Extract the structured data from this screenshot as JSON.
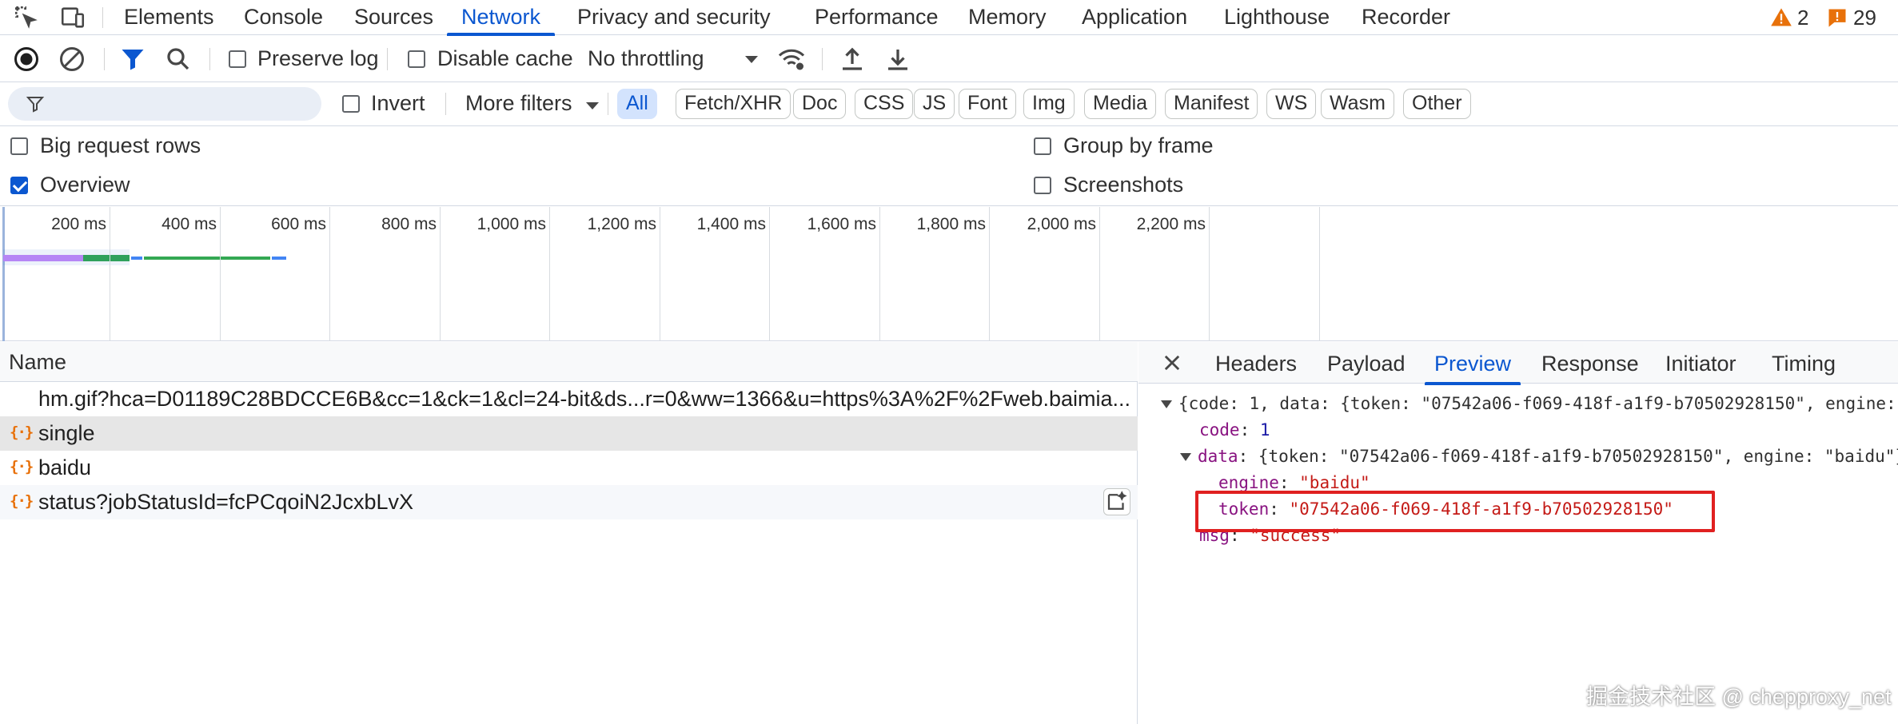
{
  "devtools_tabs": [
    {
      "label": "Elements"
    },
    {
      "label": "Console"
    },
    {
      "label": "Sources"
    },
    {
      "label": "Network"
    },
    {
      "label": "Privacy and security"
    },
    {
      "label": "Performance"
    },
    {
      "label": "Memory"
    },
    {
      "label": "Application"
    },
    {
      "label": "Lighthouse"
    },
    {
      "label": "Recorder"
    }
  ],
  "active_tab": "Network",
  "issues": {
    "warnings": "2",
    "errors": "29"
  },
  "toolbar": {
    "preserve_log_label": "Preserve log",
    "preserve_log_checked": false,
    "disable_cache_label": "Disable cache",
    "disable_cache_checked": false,
    "throttling_value": "No throttling"
  },
  "filter": {
    "value": "",
    "invert_label": "Invert",
    "more_filters_label": "More filters",
    "types": [
      "All",
      "Fetch/XHR",
      "Doc",
      "CSS",
      "JS",
      "Font",
      "Img",
      "Media",
      "Manifest",
      "WS",
      "Wasm",
      "Other"
    ],
    "active_type": "All"
  },
  "settings": {
    "big_request_rows_label": "Big request rows",
    "big_request_rows_checked": false,
    "overview_label": "Overview",
    "overview_checked": true,
    "group_by_frame_label": "Group by frame",
    "group_by_frame_checked": false,
    "screenshots_label": "Screenshots",
    "screenshots_checked": false
  },
  "overview": {
    "ticks": [
      "200 ms",
      "400 ms",
      "600 ms",
      "800 ms",
      "1,000 ms",
      "1,200 ms",
      "1,400 ms",
      "1,600 ms",
      "1,800 ms",
      "2,000 ms",
      "2,200 ms"
    ]
  },
  "requests": {
    "name_header": "Name",
    "rows": [
      {
        "name": "hm.gif?hca=D01189C28BDCCE6B&cc=1&ck=1&cl=24-bit&ds...r=0&ww=1366&u=https%3A%2F%2Fweb.baimia...",
        "type": "img",
        "selected": false
      },
      {
        "name": "single",
        "type": "fetch",
        "selected": true
      },
      {
        "name": "baidu",
        "type": "fetch",
        "selected": false
      },
      {
        "name": "status?jobStatusId=fcPCqoiN2JcxbLvX",
        "type": "fetch",
        "selected": false
      }
    ]
  },
  "details": {
    "tabs": [
      "Headers",
      "Payload",
      "Preview",
      "Response",
      "Initiator",
      "Timing"
    ],
    "active_tab": "Preview",
    "preview": {
      "root_summary": "{code: 1, data: {token: \"07542a06-f069-418f-a1f9-b70502928150\", engine: \"",
      "code_key": "code",
      "code_value": "1",
      "data_key": "data",
      "data_summary": "{token: \"07542a06-f069-418f-a1f9-b70502928150\", engine: \"baidu\"}",
      "engine_key": "engine",
      "engine_value": "\"baidu\"",
      "token_key": "token",
      "token_value": "\"07542a06-f069-418f-a1f9-b70502928150\"",
      "msg_key": "msg",
      "msg_value": "\"success\""
    }
  },
  "watermark": "掘金技术社区 @ chepproxy_net",
  "colors": {
    "accent": "#0b57d0",
    "highlight_box": "#e02020",
    "warning": "#e8710a",
    "error": "#e8710a"
  }
}
